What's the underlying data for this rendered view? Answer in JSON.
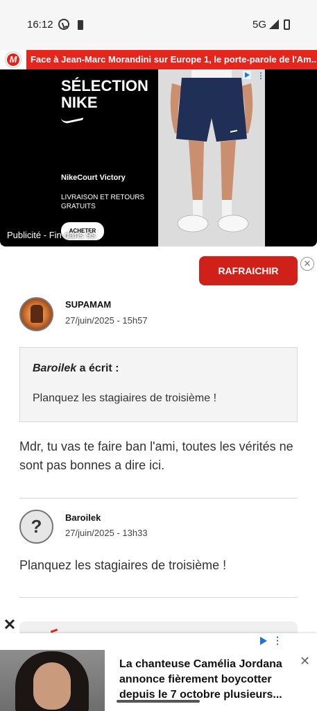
{
  "status_bar": {
    "time": "16:12",
    "network": "5G"
  },
  "ticker": {
    "logo_letter": "M",
    "headline": "Face à Jean-Marc Morandini sur Europe 1, le porte-parole de l'Am..."
  },
  "ad": {
    "title_line1": "SÉLECTION",
    "title_line2": "NIKE",
    "product": "NikeCourt Victory",
    "delivery": "LIVRAISON ET RETOURS GRATUITS",
    "buy_label": "ACHETER",
    "countdown": "Publicité - Fin dans 9s",
    "menu_glyph": "⋮"
  },
  "refresh": {
    "label": "RAFRAICHIR",
    "close_glyph": "✕"
  },
  "posts": [
    {
      "author": "SUPAMAM",
      "date": "27/juin/2025 - 15h57",
      "quote": {
        "author": "Baroilek",
        "wrote": "a écrit :",
        "text": "Planquez les stagiaires de troisième !"
      },
      "body": "Mdr, tu vas te faire ban l'ami, toutes les vérités ne sont pas bonnes a dire ici."
    },
    {
      "author": "Baroilek",
      "avatar_glyph": "?",
      "date": "27/juin/2025 - 13h33",
      "body": "Planquez les stagiaires de troisième !"
    }
  ],
  "bottom_ad": {
    "close_glyph": "✕",
    "headline": "La chanteuse Camélia Jordana annonce fièrement boycotter depuis le 7 octobre plusieurs...",
    "dismiss_glyph": "✕",
    "menu_glyph": "⋮"
  },
  "colors": {
    "brand_red": "#e3271e",
    "refresh_red": "#d0201a",
    "ad_choices_blue": "#1a73e8"
  }
}
